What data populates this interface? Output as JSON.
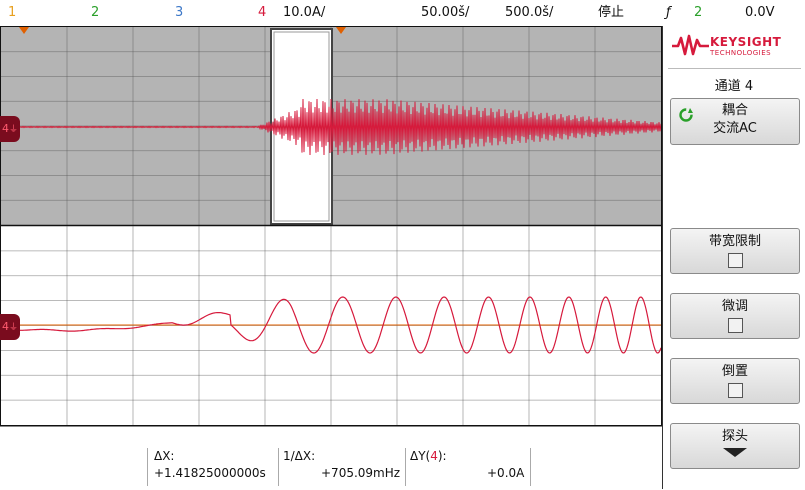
{
  "topbar": {
    "ch1": "1",
    "ch2": "2",
    "ch3": "3",
    "ch4": "4",
    "ch4_scale": "10.0A/",
    "time_scale": "50.00š/",
    "time_delay": "500.0š/",
    "run_state": "停止",
    "trigger_symbol": "ƒ",
    "trigger_channel": "2",
    "trigger_level": "0.0V"
  },
  "colors": {
    "ch1": "#e8a020",
    "ch2": "#2aa02a",
    "ch3": "#3d78c8",
    "ch4": "#d61a3c",
    "cursor": "#e06000",
    "grid_top_bg": "#b4b4b4"
  },
  "waveforms": {
    "channel_marker": "4"
  },
  "panel": {
    "brand_name": "KEYSIGHT",
    "brand_sub": "TECHNOLOGIES",
    "menu_title": "通道 4",
    "coupling_label": "耦合",
    "coupling_value": "交流AC",
    "bw_limit_label": "带宽限制",
    "fine_label": "微调",
    "invert_label": "倒置",
    "probe_label": "探头"
  },
  "readout": {
    "dx_label": "ΔX:",
    "dx_value": "+1.41825000000s",
    "inv_dx_label": "1/ΔX:",
    "inv_dx_value": "+705.09mHz",
    "dy_label_prefix": "ΔY(",
    "dy_channel": "4",
    "dy_label_suffix": "):",
    "dy_value": "+0.0A"
  }
}
